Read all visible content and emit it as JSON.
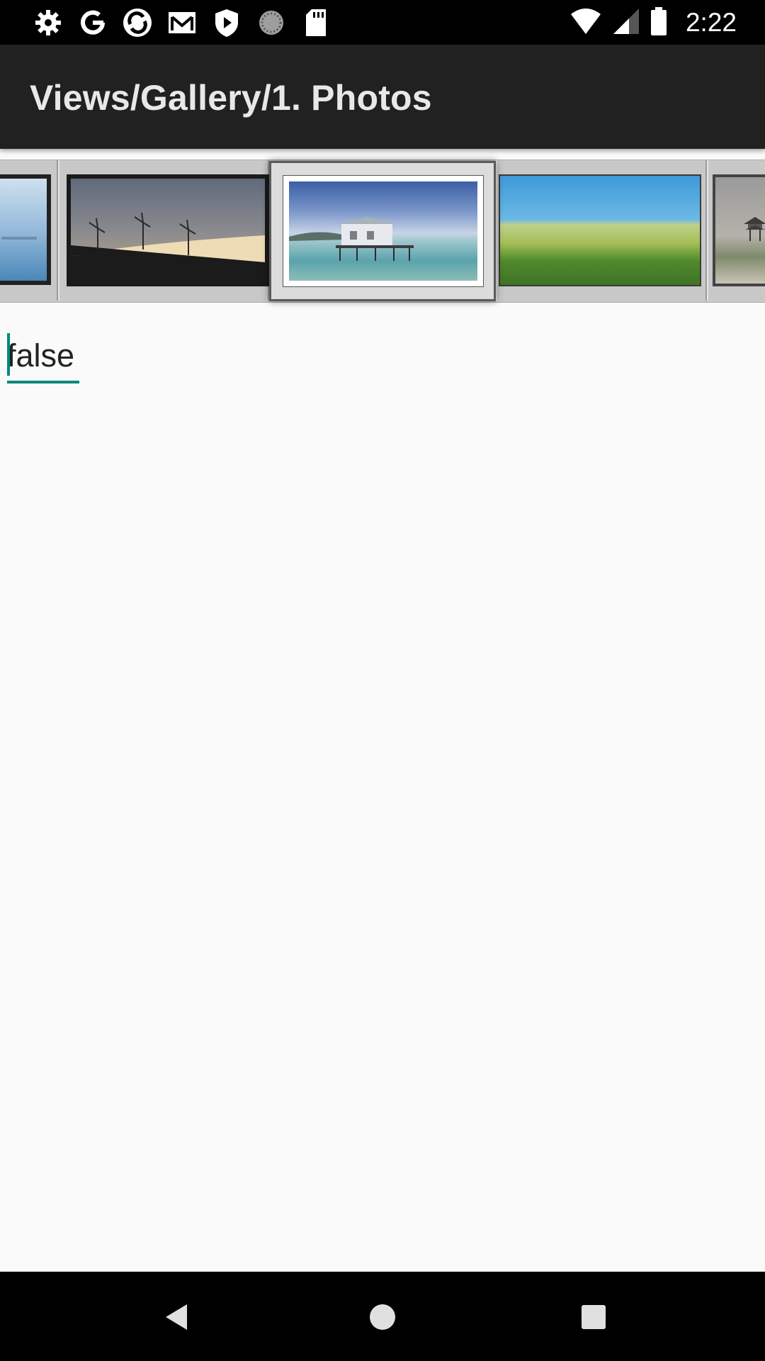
{
  "status_bar": {
    "time": "2:22",
    "left_icons": [
      "settings-icon",
      "google-icon",
      "sync-icon",
      "gmail-icon",
      "shield-icon",
      "loading-icon",
      "sd-card-icon"
    ],
    "right_icons": [
      "wifi-icon",
      "signal-icon",
      "battery-icon"
    ]
  },
  "app_bar": {
    "title": "Views/Gallery/1. Photos"
  },
  "gallery": {
    "items": [
      {
        "name": "photo-sea-partial"
      },
      {
        "name": "photo-wind-turbines"
      },
      {
        "name": "photo-boathouse"
      },
      {
        "name": "photo-green-field"
      },
      {
        "name": "photo-pagoda-partial"
      }
    ],
    "selected_item": "photo-boathouse"
  },
  "edit_text": {
    "value": "false"
  },
  "nav_bar": {
    "buttons": [
      "back-icon",
      "home-icon",
      "recents-icon"
    ]
  },
  "colors": {
    "accent": "#00897b",
    "app_bar": "#212121",
    "background": "#fafafa"
  }
}
